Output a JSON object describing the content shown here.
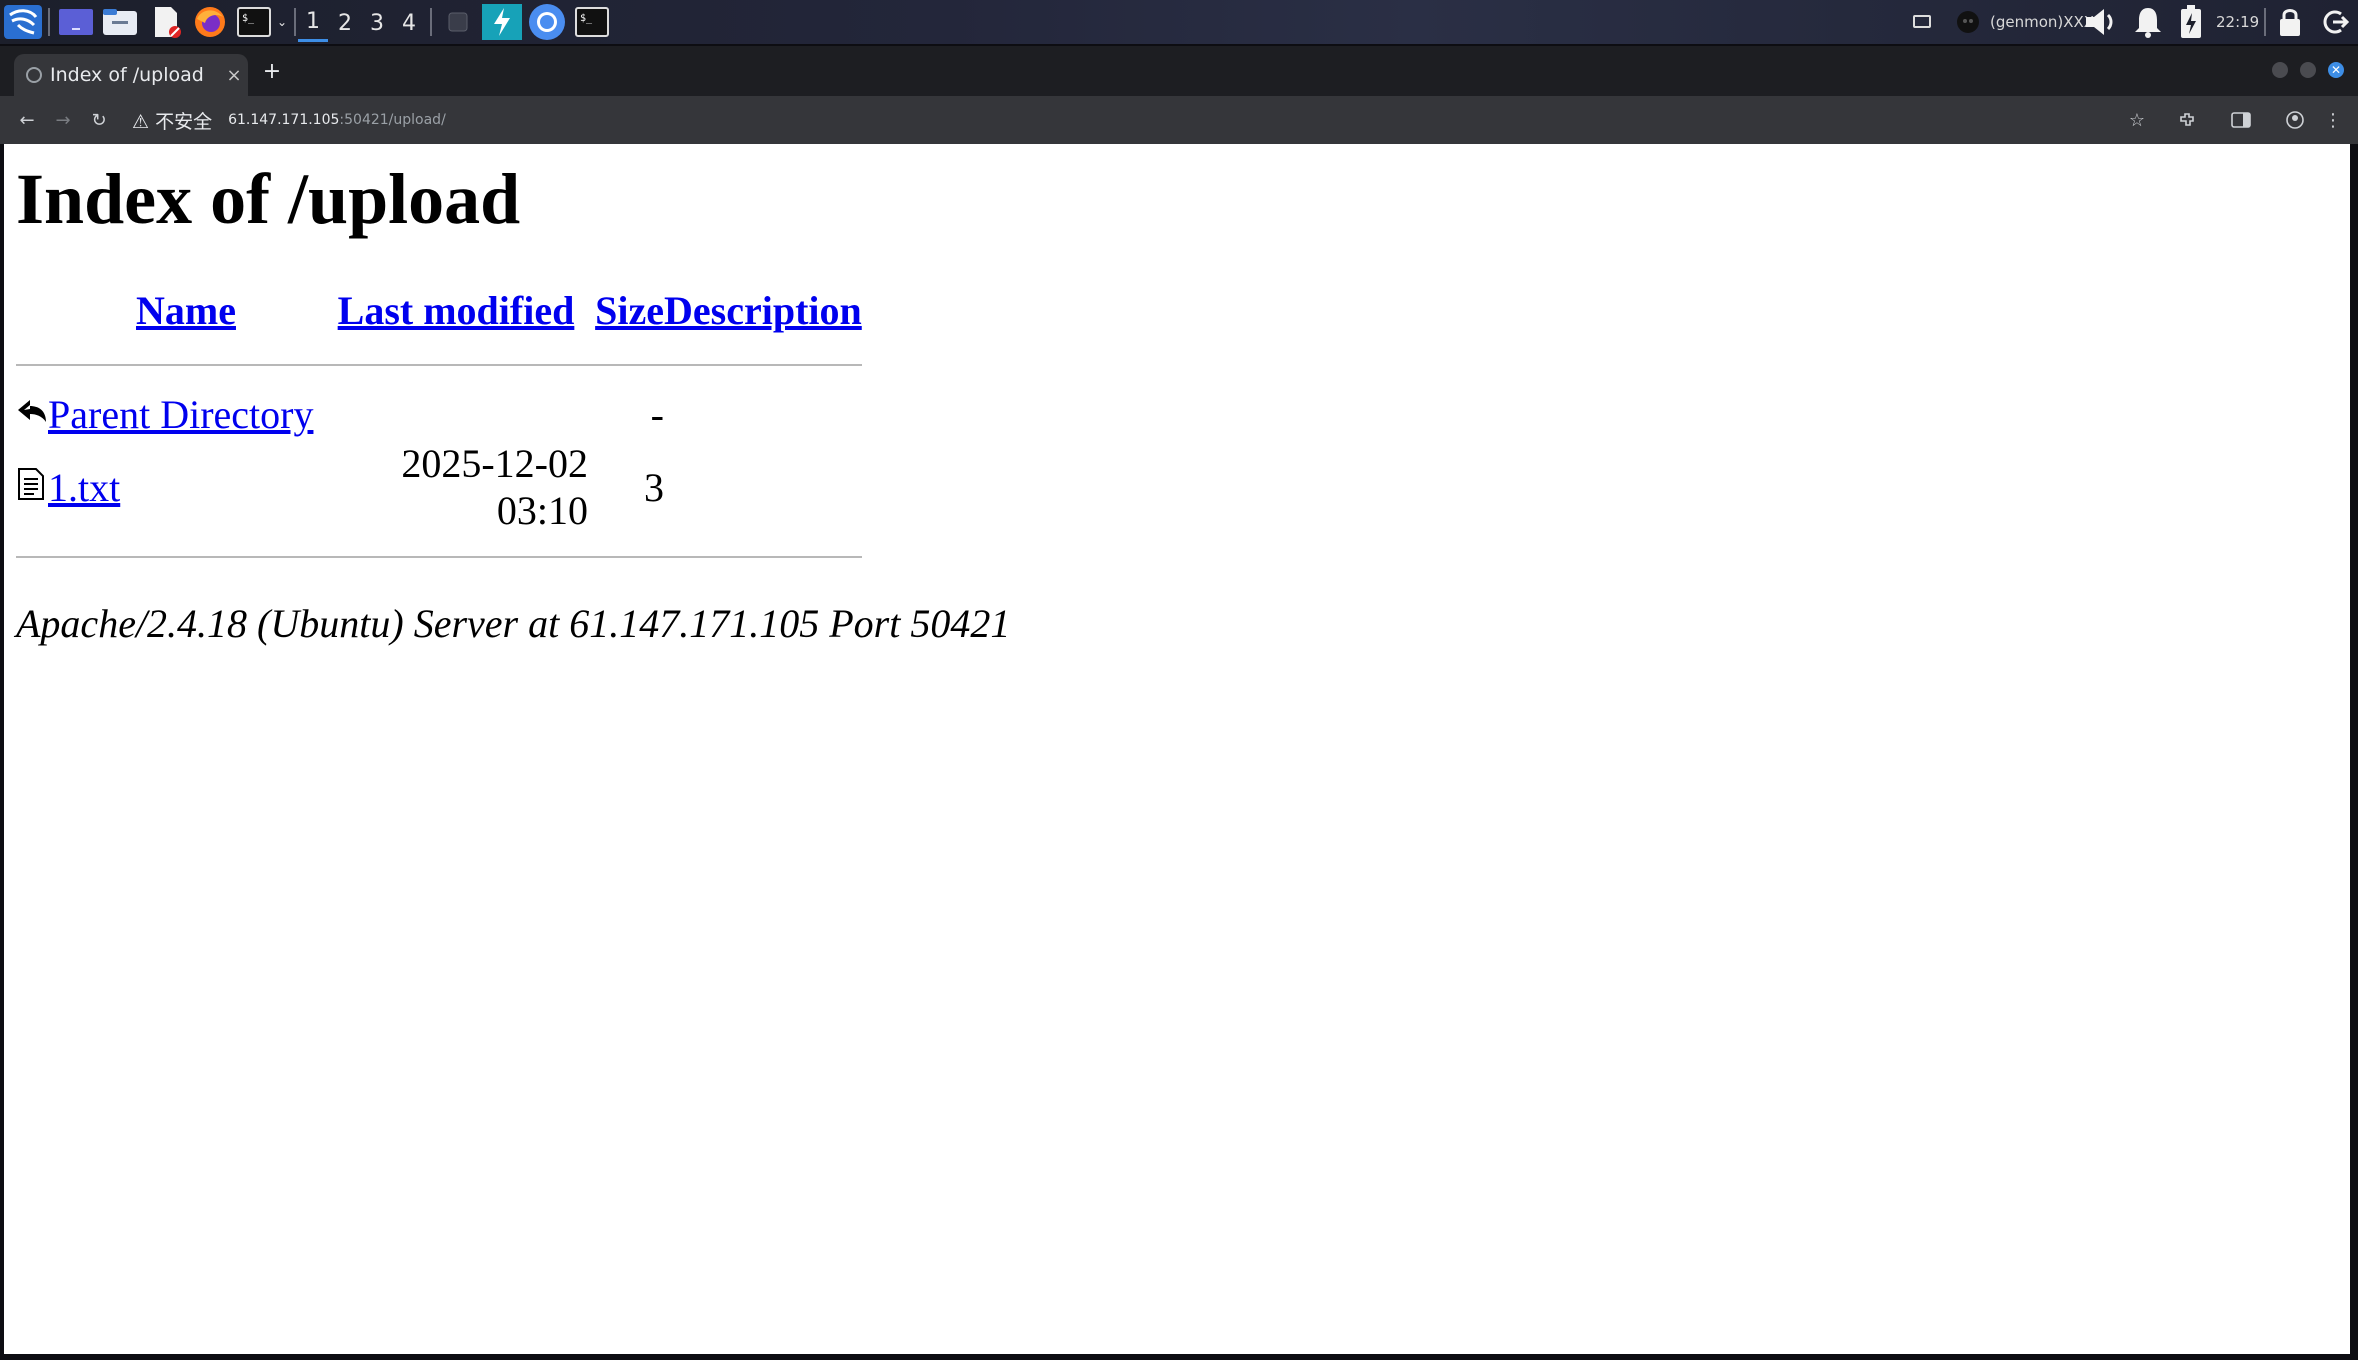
{
  "panel": {
    "workspaces": [
      "1",
      "2",
      "3",
      "4"
    ],
    "active_workspace": "1",
    "genmon_label": "(genmon)XXX",
    "clock": "22:19"
  },
  "browser": {
    "tab_title": "Index of /upload",
    "new_tab": "+",
    "tab_close": "×",
    "security_label": "⚠ 不安全",
    "url_host": "61.147.171.105",
    "url_path": ":50421/upload/"
  },
  "page": {
    "heading": "Index of /upload",
    "columns": {
      "name": "Name",
      "last_modified": "Last modified",
      "size": "Size",
      "description": "Description"
    },
    "rows": [
      {
        "icon": "back-arrow-icon",
        "name": "Parent Directory",
        "last_modified": "",
        "size": "-",
        "description": ""
      },
      {
        "icon": "text-file-icon",
        "name": "1.txt",
        "last_modified": "2025-12-02 03:10",
        "size": "3",
        "description": ""
      }
    ],
    "footer": "Apache/2.4.18 (Ubuntu) Server at 61.147.171.105 Port 50421"
  },
  "colors": {
    "link": "#0000ee",
    "panel_bg": "#1c1f2b",
    "toolbar_bg": "#35363a",
    "accent": "#3d8ee6"
  }
}
